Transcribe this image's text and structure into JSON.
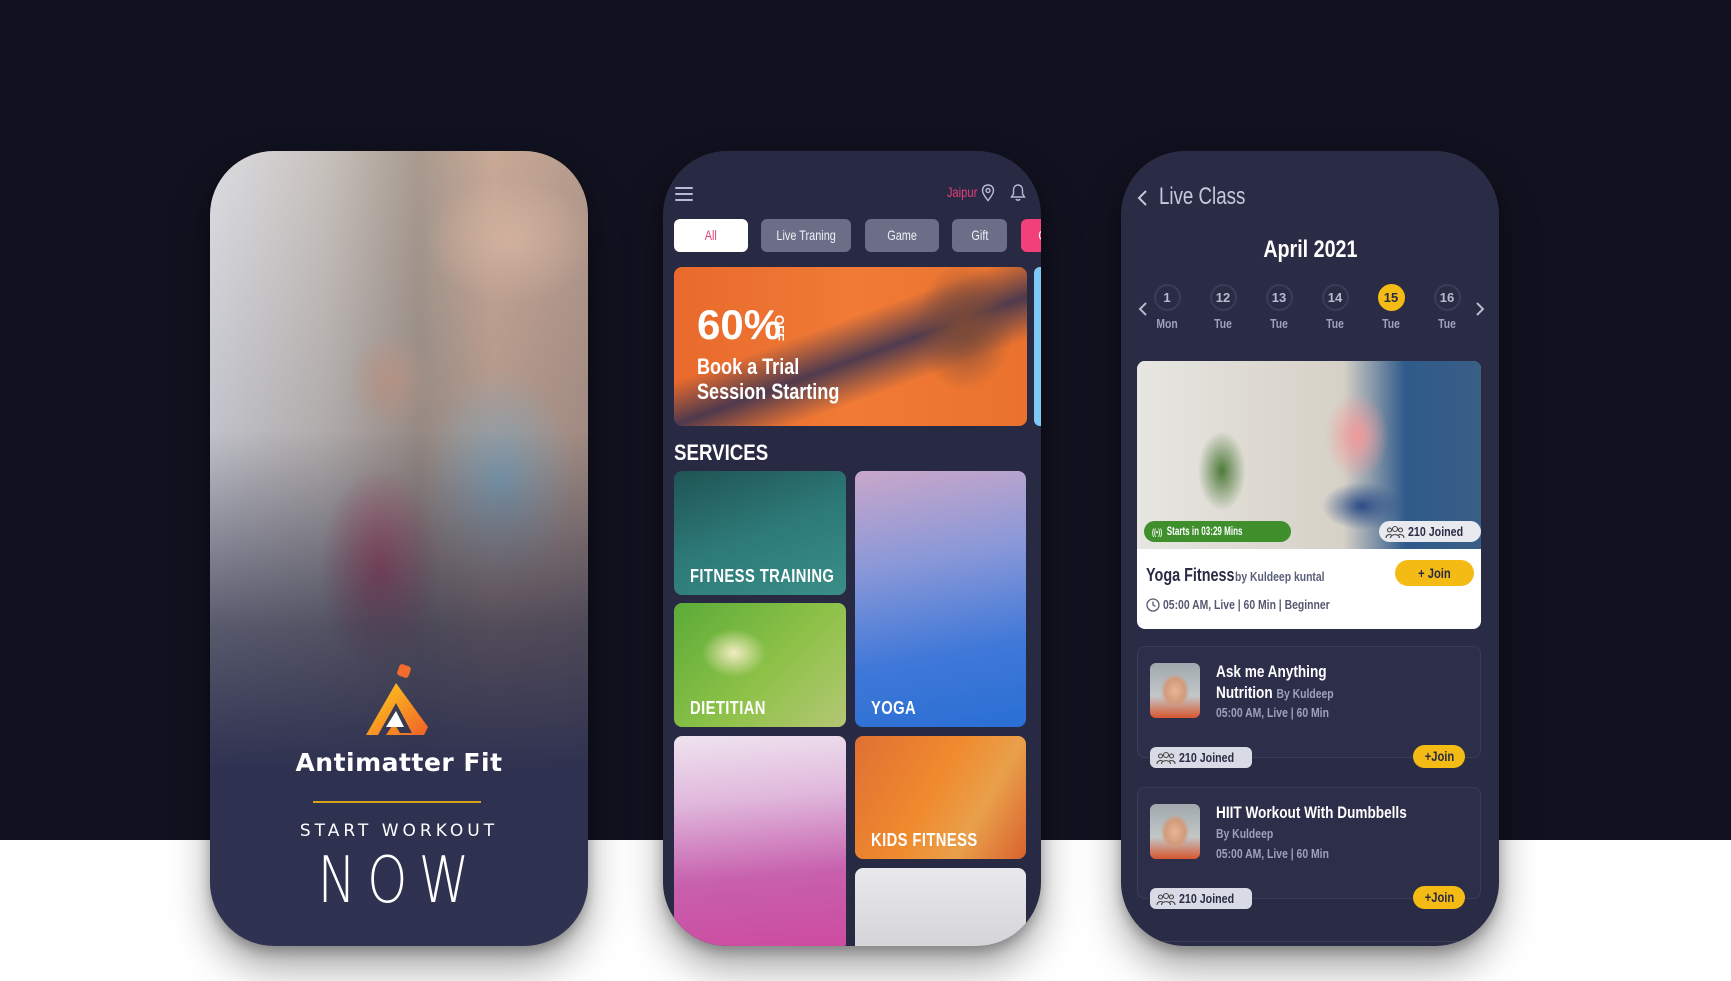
{
  "splash": {
    "brand": "Antimatter Fit",
    "tagline": "START WORKOUT",
    "cta": "NOW",
    "accent": "#d7a21a"
  },
  "home": {
    "location": "Jaipur",
    "icons": [
      "menu-icon",
      "map-pin-icon",
      "bell-icon"
    ],
    "chips": [
      {
        "label": "All",
        "active": true
      },
      {
        "label": "Live Traning"
      },
      {
        "label": "Game"
      },
      {
        "label": "Gift"
      },
      {
        "label": "Offer",
        "highlight": true
      }
    ],
    "banner": {
      "percent": "60%",
      "off": "OFF",
      "line1": "Book a Trial",
      "line2": "Session Starting"
    },
    "services_title": "SERVICES",
    "services": [
      {
        "label": "FITNESS TRAINING"
      },
      {
        "label": "YOGA"
      },
      {
        "label": "DIETITIAN"
      },
      {
        "label": ""
      },
      {
        "label": "KIDS FITNESS"
      },
      {
        "label": ""
      }
    ],
    "colors": {
      "accent": "#e2407a",
      "offer": "#f2407b"
    }
  },
  "live": {
    "title": "Live Class",
    "month": "April 2021",
    "days": [
      {
        "num": "1",
        "name": "Mon"
      },
      {
        "num": "12",
        "name": "Tue"
      },
      {
        "num": "13",
        "name": "Tue"
      },
      {
        "num": "14",
        "name": "Tue"
      },
      {
        "num": "15",
        "name": "Tue",
        "selected": true
      },
      {
        "num": "16",
        "name": "Tue"
      }
    ],
    "featured": {
      "badge": "Starts in 03:29 Mins",
      "live_glyph": "((•))",
      "joined": "210 Joined",
      "name": "Yoga Fitness",
      "by": "by Kuldeep kuntal",
      "meta": "05:00 AM, Live | 60 Min  |  Beginner",
      "join": "+  Join"
    },
    "classes": [
      {
        "title_line1": "Ask me Anything",
        "title_line2": "Nutrition",
        "by": "By Kuldeep",
        "meta": "05:00 AM, Live | 60 Min",
        "joined": "210 Joined",
        "join": "+Join"
      },
      {
        "title_line1": "HIIT Workout With Dumbbells",
        "by": "By Kuldeep",
        "meta": "05:00 AM, Live | 60 Min",
        "joined": "210 Joined",
        "join": "+Join"
      }
    ],
    "colors": {
      "join": "#f5bb15",
      "live": "#3f8f2d"
    }
  }
}
